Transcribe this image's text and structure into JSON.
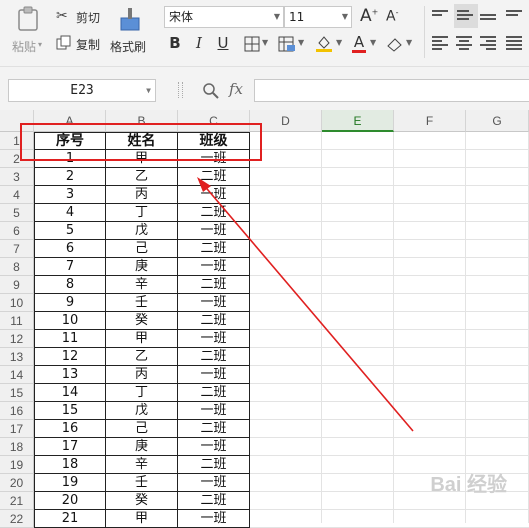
{
  "toolbar": {
    "paste_label": "粘贴",
    "cut_label": "剪切",
    "copy_label": "复制",
    "format_painter_label": "格式刷",
    "font_name": "宋体",
    "font_size": "11",
    "bold": "B",
    "italic": "I",
    "underline": "U",
    "font_color_letter": "A",
    "font_color": "#e02020",
    "fill_color": "#f2c200"
  },
  "formula_bar": {
    "cell_ref": "E23",
    "fx_label": "fx"
  },
  "sheet": {
    "columns": [
      "A",
      "B",
      "C",
      "D",
      "E",
      "F",
      "G"
    ],
    "active_column": "E",
    "header_row": [
      "序号",
      "姓名",
      "班级"
    ],
    "rows": [
      [
        "1",
        "甲",
        "一班"
      ],
      [
        "2",
        "乙",
        "二班"
      ],
      [
        "3",
        "丙",
        "一班"
      ],
      [
        "4",
        "丁",
        "二班"
      ],
      [
        "5",
        "戊",
        "一班"
      ],
      [
        "6",
        "己",
        "二班"
      ],
      [
        "7",
        "庚",
        "一班"
      ],
      [
        "8",
        "辛",
        "二班"
      ],
      [
        "9",
        "壬",
        "一班"
      ],
      [
        "10",
        "癸",
        "二班"
      ],
      [
        "11",
        "甲",
        "一班"
      ],
      [
        "12",
        "乙",
        "二班"
      ],
      [
        "13",
        "丙",
        "一班"
      ],
      [
        "14",
        "丁",
        "二班"
      ],
      [
        "15",
        "戊",
        "一班"
      ],
      [
        "16",
        "己",
        "二班"
      ],
      [
        "17",
        "庚",
        "一班"
      ],
      [
        "18",
        "辛",
        "二班"
      ],
      [
        "19",
        "壬",
        "一班"
      ],
      [
        "20",
        "癸",
        "二班"
      ],
      [
        "21",
        "甲",
        "一班"
      ]
    ],
    "row_numbers": [
      "1",
      "2",
      "3",
      "4",
      "5",
      "6",
      "7",
      "8",
      "9",
      "10",
      "11",
      "12",
      "13",
      "14",
      "15",
      "16",
      "17",
      "18",
      "19",
      "20",
      "21",
      "22"
    ]
  },
  "annotation": {
    "color": "#e02020"
  },
  "watermark": "Bai 经验"
}
